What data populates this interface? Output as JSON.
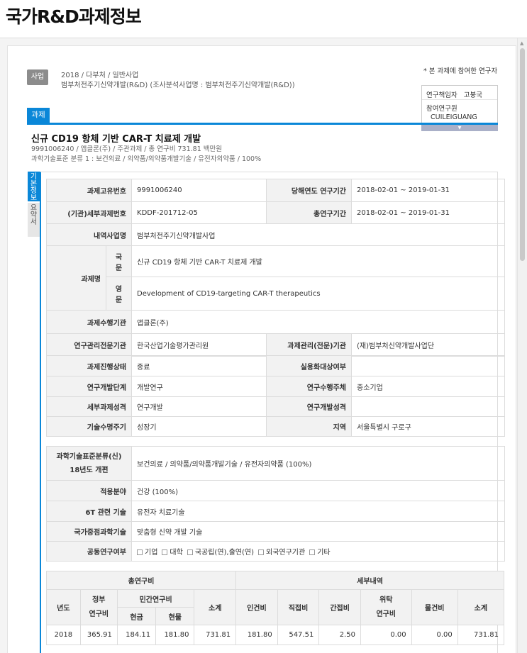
{
  "page_title": "국가R&D과제정보",
  "business": {
    "badge": "사업",
    "line1": "2018 / 다부처 / 일반사업",
    "line2": "범부처전주기신약개발(R&D) (조사분석사업명 : 범부처전주기신약개발(R&D))"
  },
  "researchers": {
    "note": "* 본 과제에 참여한 연구자",
    "lead_label": "연구책임자",
    "lead_name": "고붕국",
    "member_label": "참여연구원",
    "member_name": "CUILEIGUANG"
  },
  "tab_label": "과제",
  "project": {
    "title": "신규 CD19 항체 기반 CAR-T 치료제 개발",
    "meta1": "9991006240 / 앱클론(주) / 주관과제 / 총 연구비 731.81 백만원",
    "meta2": "과학기술표준 분류 1 : 보건의료 / 의약품/의약품개발기술 / 유전자의약품 / 100%"
  },
  "vtabs": {
    "basic": [
      "기",
      "본",
      "정",
      "보"
    ],
    "summary": [
      "요",
      "약",
      "서"
    ]
  },
  "basic_info": {
    "task_no_label": "과제고유번호",
    "task_no": "9991006240",
    "year_period_label": "당해연도 연구기간",
    "year_period": "2018-02-01 ~ 2019-01-31",
    "detail_no_label": "(기관)세부과제번호",
    "detail_no": "KDDF-201712-05",
    "total_period_label": "총연구기간",
    "total_period": "2018-02-01 ~ 2019-01-31",
    "sub_business_label": "내역사업명",
    "sub_business": "범부처전주기신약개발사업",
    "name_label": "과제명",
    "kor_label": [
      "국",
      "문"
    ],
    "kor_name": "신규 CD19 항체 기반 CAR-T 치료제 개발",
    "eng_label": [
      "영",
      "문"
    ],
    "eng_name": "Development of CD19-targeting CAR-T therapeutics",
    "org_label": "과제수행기관",
    "org": "앱클론(주)",
    "mgmt_label": "연구관리전문기관",
    "mgmt": "한국산업기술평가관리원",
    "task_mgmt_label": "과제관리(전문)기관",
    "task_mgmt": "(재)범부처신약개발사업단"
  },
  "status_info": {
    "status_label": "과제진행상태",
    "status": "종료",
    "commercial_label": "실용화대상여부",
    "commercial": "",
    "stage_label": "연구개발단계",
    "stage": "개발연구",
    "performer_label": "연구수행주체",
    "performer": "중소기업",
    "nature_label": "세부과제성격",
    "nature": "연구개발",
    "dev_nature_label": "연구개발성격",
    "dev_nature": "",
    "lifecycle_label": "기술수명주기",
    "lifecycle": "성장기",
    "region_label": "지역",
    "region": "서울특별시 구로구"
  },
  "classification": {
    "std_label1": "과학기술표준분류(신)",
    "std_label2": "18년도 개편",
    "std": "보건의료 / 의약품/의약품개발기술 / 유전자의약품 (100%)",
    "field_label": "적용분야",
    "field": "건강 (100%)",
    "sixt_label": "6T 관련 기술",
    "sixt": "유전자 치료기술",
    "national_label": "국가중점과학기술",
    "national": "맞춤형 신약 개발 기술",
    "joint_label": "공동연구여부",
    "joint_options": [
      "기업",
      "대학",
      "국공립(연),출연(연)",
      "외국연구기관",
      "기타"
    ]
  },
  "budget": {
    "total_label": "총연구비",
    "detail_label": "세부내역",
    "year_label": "년도",
    "gov_label": [
      "정부",
      "연구비"
    ],
    "private_label": "민간연구비",
    "cash_label": "현금",
    "inkind_label": "현물",
    "subtotal_label": "소계",
    "labor_label": "인건비",
    "direct_label": "직접비",
    "indirect_label": "간접비",
    "consign_label": [
      "위탁",
      "연구비"
    ],
    "goods_label": "물건비",
    "subtotal2_label": "소계",
    "row": {
      "year": "2018",
      "gov": "365.91",
      "cash": "184.11",
      "inkind": "181.80",
      "subtotal": "731.81",
      "labor": "181.80",
      "direct": "547.51",
      "indirect": "2.50",
      "consign": "0.00",
      "goods": "0.00",
      "subtotal2": "731.81"
    }
  }
}
